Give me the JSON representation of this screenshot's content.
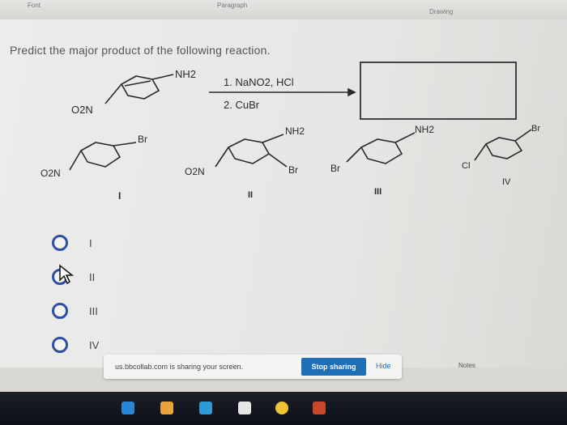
{
  "ribbon": {
    "font_label": "Font",
    "paragraph_label": "Paragraph",
    "drawing_label": "Drawing"
  },
  "question": {
    "prompt": "Predict the major product of the following reaction."
  },
  "reaction": {
    "reactant_group_top": "NH2",
    "reactant_group_bottom": "O2N",
    "step1": "1. NaNO2, HCl",
    "step2": "2. CuBr"
  },
  "structures": [
    {
      "roman": "I",
      "groups": [
        "Br",
        "O2N"
      ]
    },
    {
      "roman": "II",
      "groups": [
        "NH2",
        "O2N",
        "Br"
      ]
    },
    {
      "roman": "III",
      "groups": [
        "NH2",
        "Br"
      ]
    },
    {
      "roman": "IV",
      "groups": [
        "Br",
        "Cl"
      ]
    }
  ],
  "options": [
    {
      "label": "I"
    },
    {
      "label": "II"
    },
    {
      "label": "III"
    },
    {
      "label": "IV"
    }
  ],
  "share_bar": {
    "message": "us.bbcollab.com is sharing your screen.",
    "stop_label": "Stop sharing",
    "hide_label": "Hide"
  },
  "notes_label": "Notes",
  "colors": {
    "radio_border": "#2e4fa2",
    "stop_button": "#1f6fb8",
    "taskbar": "#101318"
  }
}
